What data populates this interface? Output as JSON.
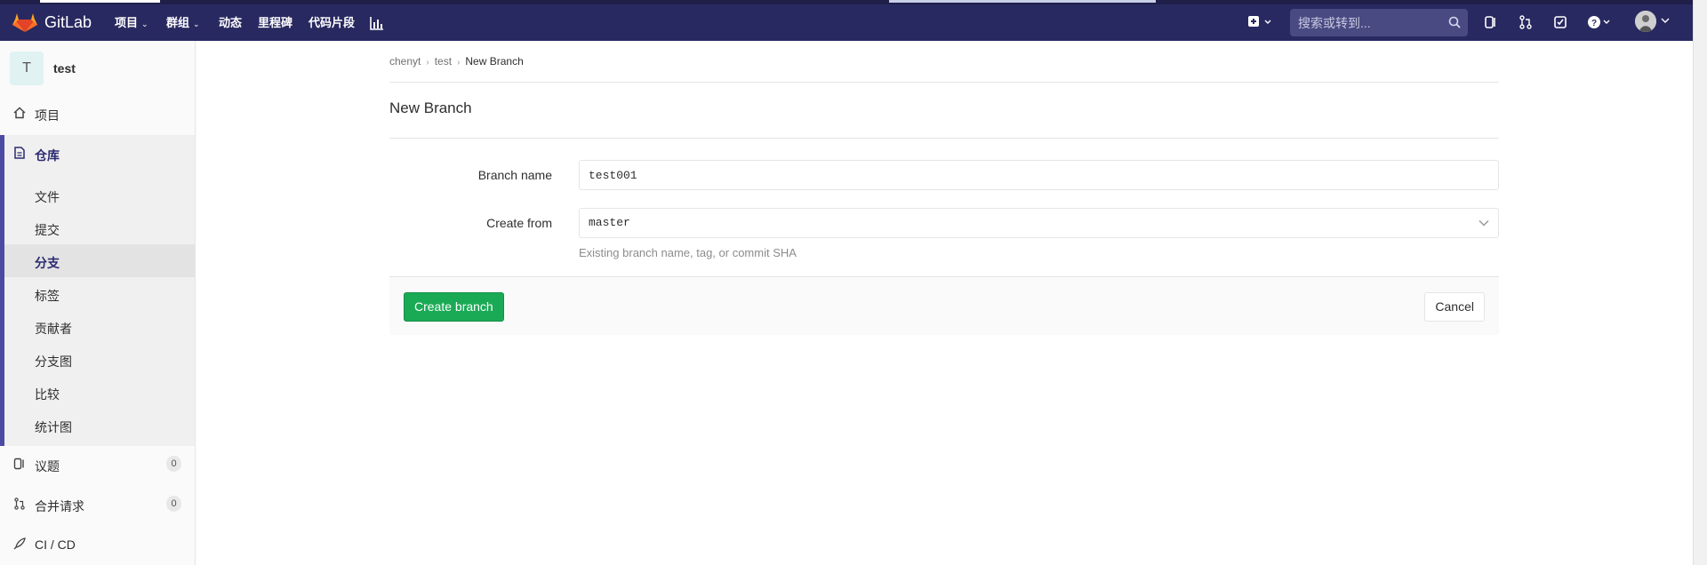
{
  "app": {
    "brand": "GitLab"
  },
  "topnav": {
    "items": [
      {
        "label": "项目",
        "caret": "⌄"
      },
      {
        "label": "群组",
        "caret": "⌄"
      },
      {
        "label": "动态",
        "caret": ""
      },
      {
        "label": "里程碑",
        "caret": ""
      },
      {
        "label": "代码片段",
        "caret": ""
      }
    ],
    "chart_icon": "bar-chart-icon",
    "search_placeholder": "搜索或转到...",
    "icons": [
      "plus-square-icon",
      "search-icon",
      "issues-icon",
      "merge-request-icon",
      "todo-icon",
      "help-icon",
      "avatar"
    ]
  },
  "sidebar": {
    "project_initial": "T",
    "project_name": "test",
    "project_label": "项目",
    "repo_label": "仓库",
    "repo_items": [
      {
        "label": "文件",
        "active": false
      },
      {
        "label": "提交",
        "active": false
      },
      {
        "label": "分支",
        "active": true
      },
      {
        "label": "标签",
        "active": false
      },
      {
        "label": "贡献者",
        "active": false
      },
      {
        "label": "分支图",
        "active": false
      },
      {
        "label": "比较",
        "active": false
      },
      {
        "label": "统计图",
        "active": false
      }
    ],
    "issues_label": "议题",
    "issues_count": "0",
    "mr_label": "合并请求",
    "mr_count": "0",
    "cicd_label": "CI / CD"
  },
  "breadcrumb": {
    "items": [
      "chenyt",
      "test"
    ],
    "current": "New Branch"
  },
  "page": {
    "title": "New Branch",
    "branch_name_label": "Branch name",
    "branch_name_value": "test001",
    "create_from_label": "Create from",
    "create_from_value": "master",
    "help_text": "Existing branch name, tag, or commit SHA",
    "create_button": "Create branch",
    "cancel_button": "Cancel"
  },
  "colors": {
    "navbar": "#292961",
    "accent": "#4b4ba3",
    "success": "#1aaa55"
  }
}
